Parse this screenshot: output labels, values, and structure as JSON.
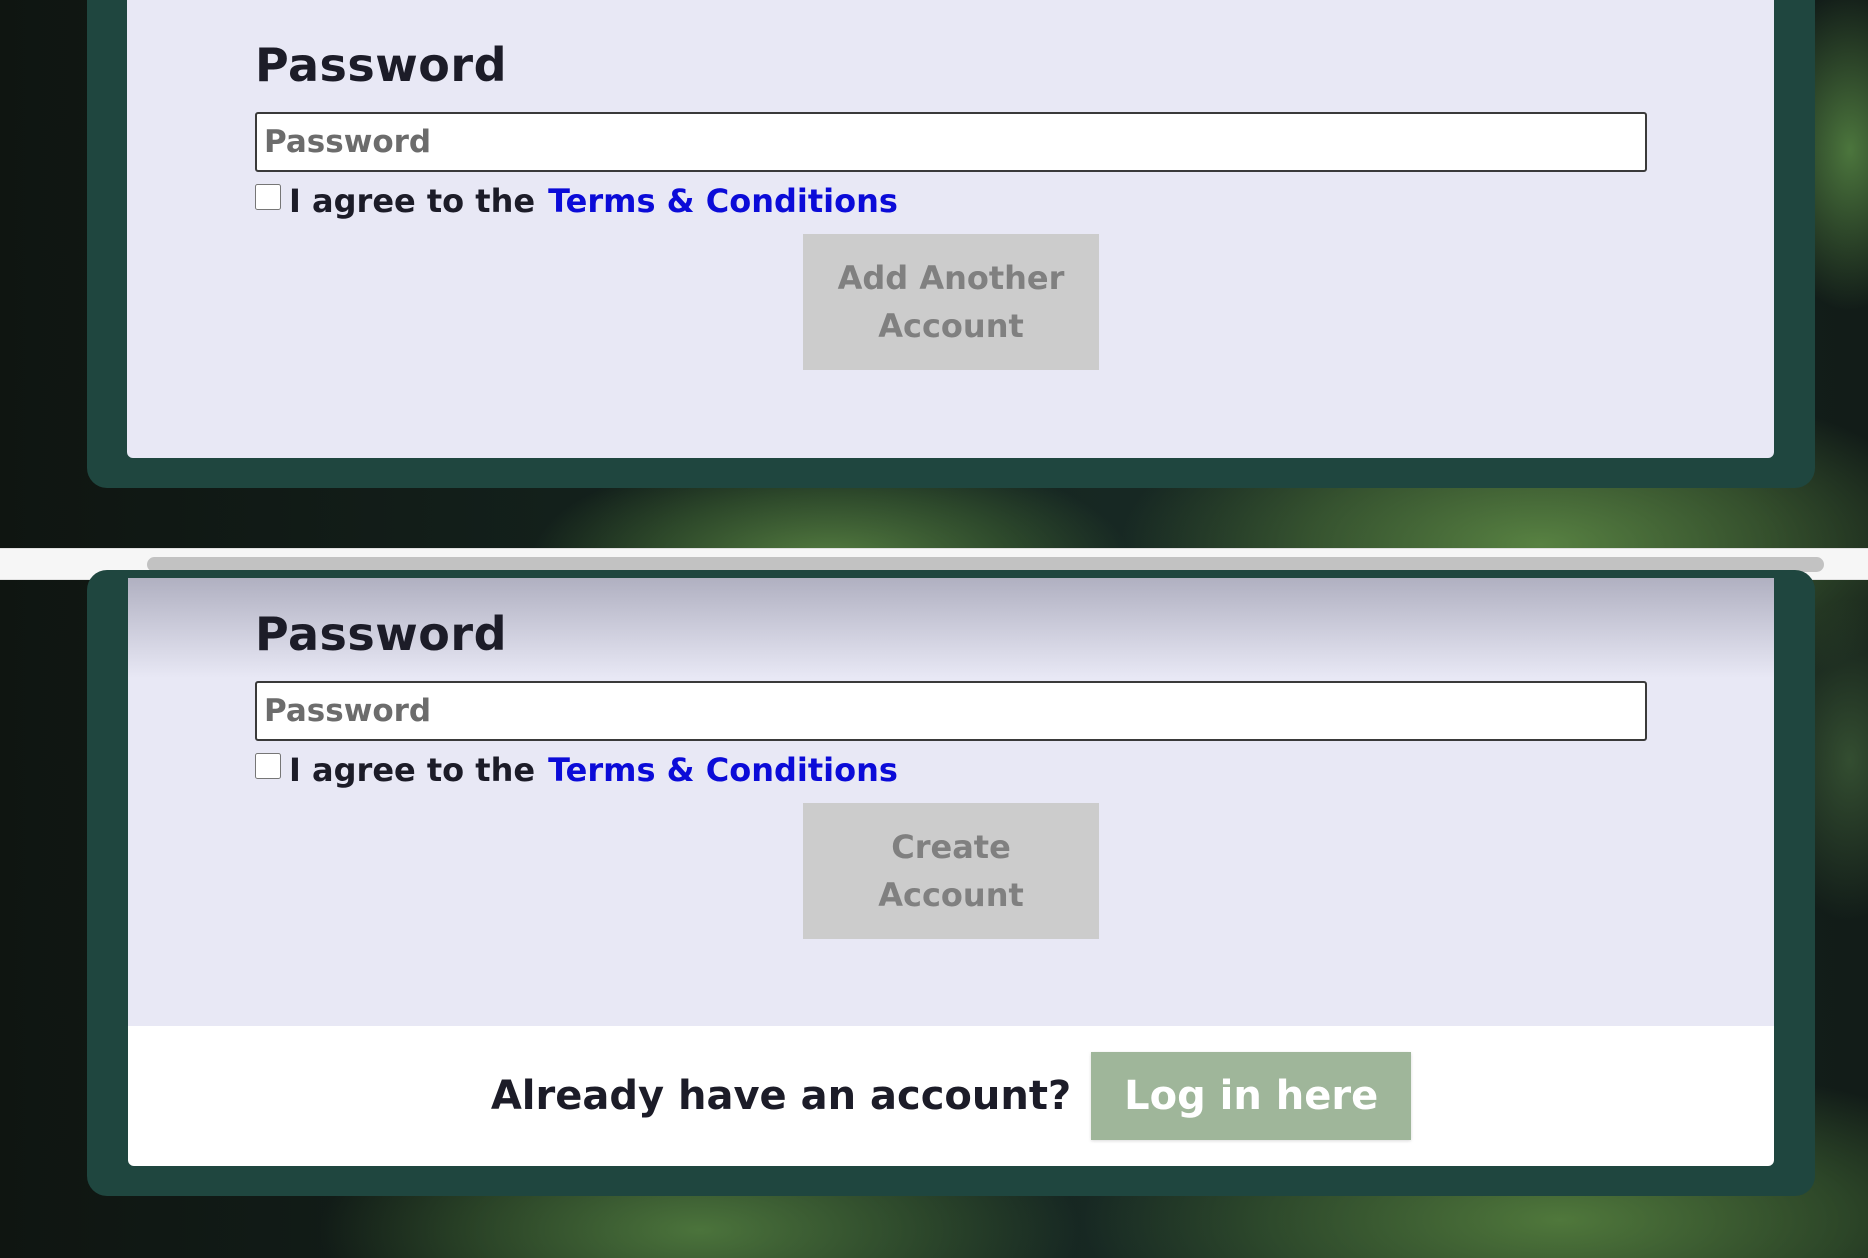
{
  "top_form": {
    "password_label": "Password",
    "password_placeholder": "Password",
    "agree_text": "I agree to the",
    "terms_link": "Terms & Conditions",
    "submit_label": "Add Another Account"
  },
  "bottom_form": {
    "password_label": "Password",
    "password_placeholder": "Password",
    "agree_text": "I agree to the",
    "terms_link": "Terms & Conditions",
    "submit_label": "Create Account"
  },
  "login": {
    "prompt": "Already have an account?",
    "button_label": "Log in here"
  },
  "colors": {
    "panel_bg": "#e8e8f5",
    "frame": "#1f463f",
    "link": "#0b0bd8",
    "disabled_button": "#cccccc",
    "login_button": "#9fb69a"
  }
}
